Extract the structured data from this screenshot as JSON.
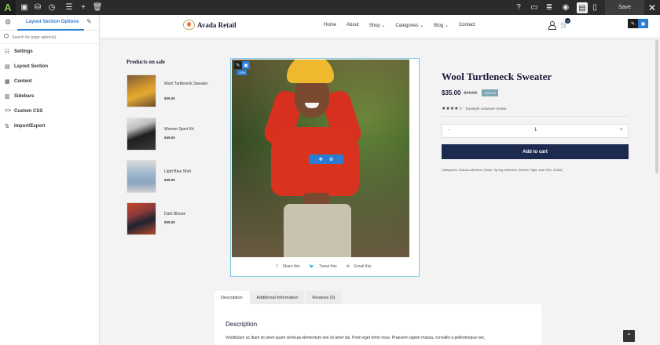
{
  "toolbar": {
    "save_label": "Save",
    "icons": [
      "avada-logo",
      "layout-icon",
      "store-icon",
      "history-icon",
      "library-icon",
      "add-icon",
      "trash-icon",
      "help-icon",
      "desktop-icon",
      "layers-icon",
      "preview-icon",
      "page-icon",
      "device-icon",
      "close-icon"
    ]
  },
  "sidebar": {
    "tab_title": "Layout Section Options",
    "search_placeholder": "Search for page option(s)",
    "items": [
      {
        "label": "Settings",
        "icon": "sliders-icon"
      },
      {
        "label": "Layout Section",
        "icon": "layout-icon"
      },
      {
        "label": "Content",
        "icon": "content-icon"
      },
      {
        "label": "Sidebars",
        "icon": "sidebar-icon"
      },
      {
        "label": "Custom CSS",
        "icon": "code-icon"
      },
      {
        "label": "Import/Export",
        "icon": "transfer-icon"
      }
    ]
  },
  "header": {
    "brand": "Avada Retail",
    "nav": [
      "Home",
      "About",
      "Shop ⌄",
      "Categories ⌄",
      "Blog ⌄",
      "Contact"
    ],
    "cart_count": "0"
  },
  "sale": {
    "title": "Products on sale",
    "items": [
      {
        "name": "Wool Turtleneck Sweater",
        "price": "$35.00"
      },
      {
        "name": "Women Sport Kit",
        "price": "$45.00"
      },
      {
        "name": "Light Blue Shirt",
        "price": "$45.00"
      },
      {
        "name": "Dark Blouse",
        "price": "$35.00"
      }
    ]
  },
  "gallery": {
    "discount_badge": "-15%",
    "share": [
      {
        "icon": "facebook-icon",
        "label": "Share this"
      },
      {
        "icon": "twitter-icon",
        "label": "Tweet this"
      },
      {
        "icon": "email-icon",
        "label": "Email this"
      }
    ]
  },
  "product": {
    "title": "Wool Turtleneck Sweater",
    "price": "$35.00",
    "old_price": "$40.00",
    "discount": "13% Off",
    "rating": 3.5,
    "stars": "★★★★☆",
    "review_text": "Example customer review",
    "qty_minus": "-",
    "qty_value": "1",
    "qty_plus": "+",
    "add_to_cart": "Add to cart",
    "meta": "Categories: Casual collection, Deals, Spring collection, Women   Tags: sale   SKU: 81208"
  },
  "tabs": [
    {
      "label": "Description",
      "active": true
    },
    {
      "label": "Additional information",
      "active": false
    },
    {
      "label": "Reviews (0)",
      "active": false
    }
  ],
  "description": {
    "title": "Description",
    "text": "Vestibulum ac diam sit amet quam vehicula elementum sed sit amet dui. Proin eget tortor risus. Praesent sapien massa, convallis a pellentesque nec,"
  },
  "colors": {
    "accent": "#2b7cd3",
    "navy": "#1b2a4e",
    "toolbar": "#2b2b2b"
  }
}
